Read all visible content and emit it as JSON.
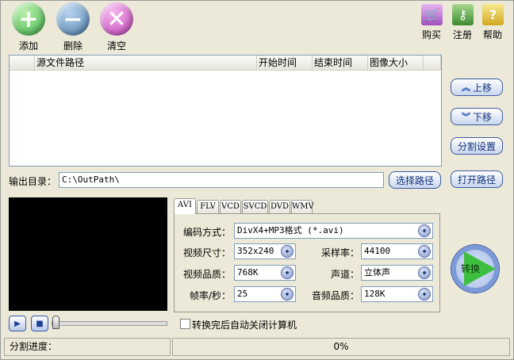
{
  "toolbar": {
    "add": "添加",
    "delete": "删除",
    "clear": "清空",
    "buy": "购买",
    "register": "注册",
    "help": "帮助"
  },
  "list": {
    "columns": [
      "源文件路径",
      "开始时间",
      "结束时间",
      "图像大小"
    ]
  },
  "side": {
    "up": "上移",
    "down": "下移",
    "split": "分割设置",
    "open": "打开路径"
  },
  "output": {
    "label": "输出目录：",
    "value": "C:\\OutPath\\",
    "choose": "选择路径"
  },
  "tabs": [
    "AVI",
    "FLV",
    "VCD",
    "SVCD",
    "DVD",
    "WMV"
  ],
  "settings": {
    "codec_label": "编码方式：",
    "codec": "DivX4+MP3格式 (*.avi)",
    "size_label": "视频尺寸：",
    "size": "352x240",
    "vq_label": "视频品质：",
    "vq": "768K",
    "fps_label": "帧率/秒：",
    "fps": "25",
    "sr_label": "采样率：",
    "sr": "44100",
    "ch_label": "声道：",
    "ch": "立体声",
    "aq_label": "音频品质：",
    "aq": "128K"
  },
  "convert": "转换",
  "shutdown": "转换完后自动关闭计算机",
  "status": {
    "split_label": "分割进度：",
    "progress": "0%"
  }
}
